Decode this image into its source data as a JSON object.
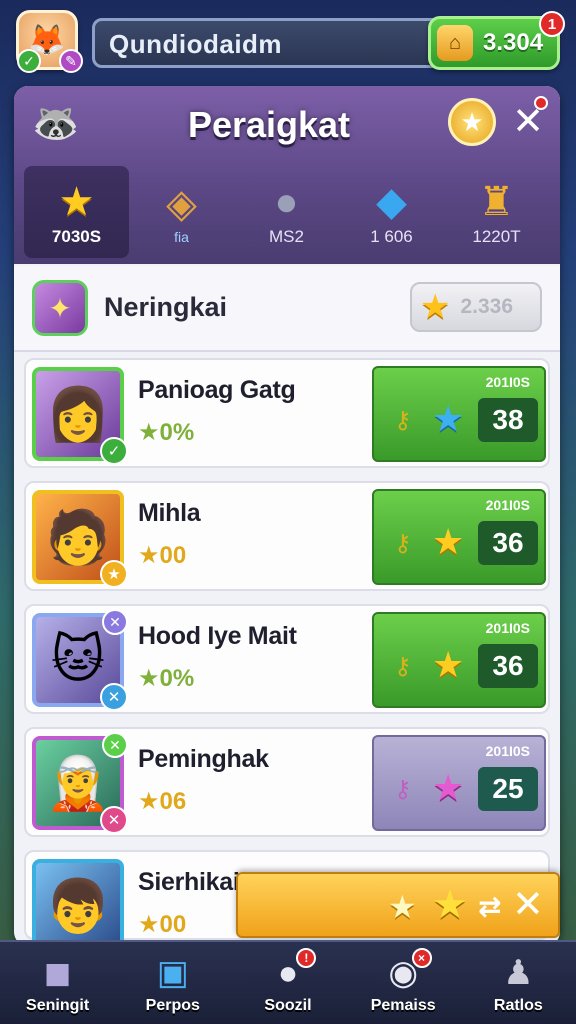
{
  "top": {
    "search_text": "Qundiodaidm",
    "currency_value": "3.304",
    "currency_notification": "1"
  },
  "panel": {
    "title": "Peraigkat",
    "categories": [
      {
        "label": "7030S",
        "icon": "star-icon"
      },
      {
        "label": "",
        "icon": "chest-icon"
      },
      {
        "label": "MS2",
        "icon": "mouse-icon"
      },
      {
        "label": "1 606",
        "icon": "gem-icon"
      },
      {
        "label": "1220T",
        "icon": "trophy-icon"
      }
    ],
    "chest_tag": "fia"
  },
  "subheader": {
    "title": "Neringkai",
    "score": "2.336"
  },
  "players": [
    {
      "name": "Panioag Gatg",
      "stat": "0%",
      "reward_label": "201I0S",
      "reward_value": "38",
      "reward_style": "green",
      "star_color": "blue"
    },
    {
      "name": "Mihla",
      "stat": "00",
      "reward_label": "201I0S",
      "reward_value": "36",
      "reward_style": "green",
      "star_color": "gold"
    },
    {
      "name": "Hood Iye Mait",
      "stat": "0%",
      "reward_label": "201I0S",
      "reward_value": "36",
      "reward_style": "green",
      "star_color": "gold"
    },
    {
      "name": "Peminghak",
      "stat": "06",
      "reward_label": "201I0S",
      "reward_value": "25",
      "reward_style": "purple",
      "star_color": "pink"
    },
    {
      "name": "Sierhikait",
      "stat": "00"
    }
  ],
  "nav": [
    {
      "label": "Seningit",
      "icon": "cube-icon"
    },
    {
      "label": "Perpos",
      "icon": "chest-icon",
      "badge": ""
    },
    {
      "label": "Soozil",
      "icon": "chat-icon",
      "badge": "!"
    },
    {
      "label": "Pemaiss",
      "icon": "controller-icon",
      "badge": "×"
    },
    {
      "label": "Ratlos",
      "icon": "profile-icon"
    }
  ],
  "colors": {
    "green_reward": "#3a9a2a",
    "purple_reward": "#8e86b8",
    "header_purple": "#5a4784",
    "gold": "#ffcc22"
  }
}
